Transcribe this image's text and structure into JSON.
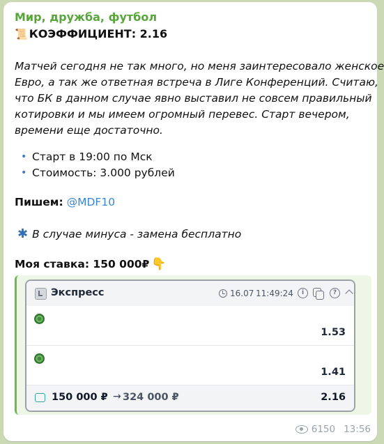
{
  "post": {
    "channel_name": "Мир, дружба, футбол",
    "coef_icon": "📜",
    "coef_line": "КОЭФФИЦИЕНТ: 2.16",
    "paragraph_lines": [
      "Матчей сегодня не так много, но меня заинтересовало женское",
      "Евро, а так же ответная встреча в Лиге Конференций.  Считаю,",
      "что БК в данном случае явно выставил не совсем правильный",
      "котировки и мы имеем огромный перевес. Старт вечером,",
      "времени еще достаточно."
    ],
    "bullets": [
      {
        "dot": "•",
        "text": "Старт в 19:00 по Мск"
      },
      {
        "dot": "•",
        "text": "Стоимость: 3.000 рублей"
      }
    ],
    "write_label": "Пишем:",
    "write_handle": "@MDF10",
    "minus_asterisk": "✱",
    "minus_text": "В случае минуса - замена бесплатно",
    "stake_label": "Моя ставка: 150 000₽",
    "stake_hand_icon": "👇"
  },
  "coupon": {
    "title": "Экспресс",
    "date": "16.07",
    "time": "11:49:24",
    "info_glyph": "i",
    "help_glyph": "?",
    "rows": [
      {
        "sport_icon": "soccer-ball-icon",
        "coef": "1.53"
      },
      {
        "sport_icon": "soccer-ball-icon",
        "coef": "1.41"
      }
    ],
    "stake": "150 000 ₽",
    "arrow": "→",
    "potential_win": "324 000 ₽",
    "total_coef": "2.16"
  },
  "meta": {
    "views": "6150",
    "time": "13:56"
  },
  "colors": {
    "channel_name": "#58a53c",
    "handle": "#3a86d4",
    "quote_bar": "#6bbb4a"
  }
}
